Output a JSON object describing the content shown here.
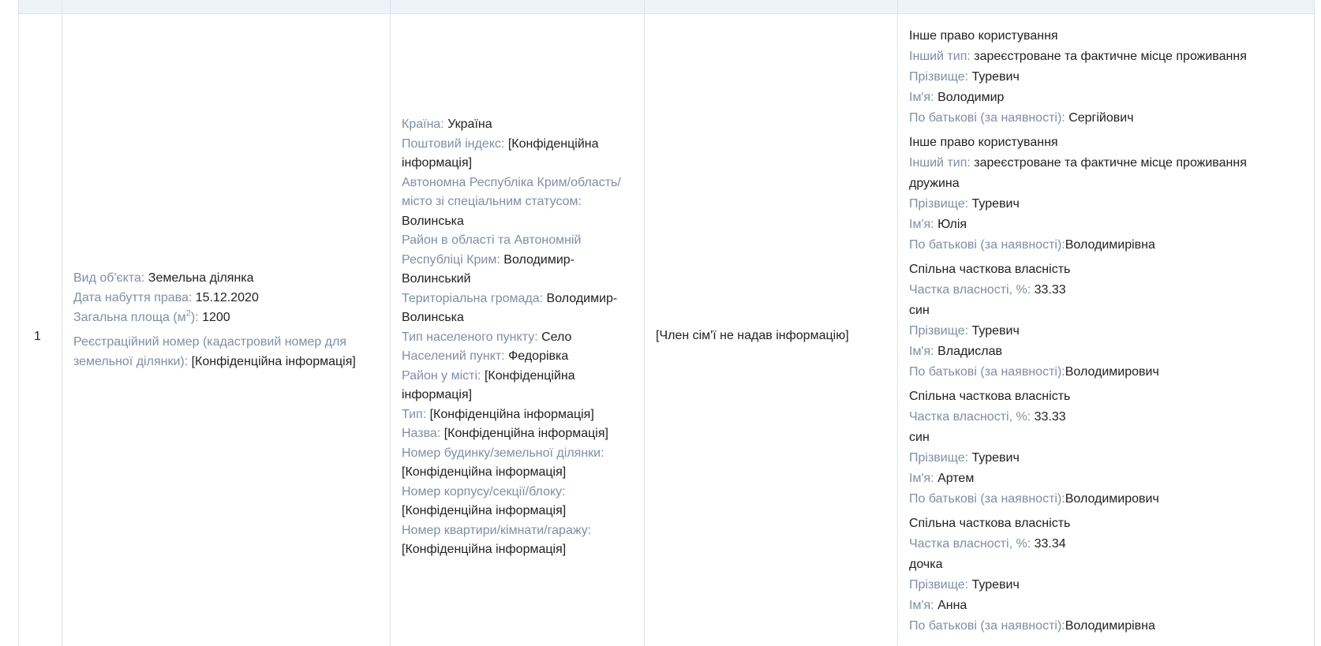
{
  "row_number": "1",
  "object": {
    "type_label": "Вид об'єкта:",
    "type_value": "Земельна ділянка",
    "date_label": "Дата набуття права:",
    "date_value": "15.12.2020",
    "area_label_prefix": "Загальна площа (м",
    "area_label_sup": "2",
    "area_label_suffix": "):",
    "area_value": "1200",
    "cadastral_label": "Реєстраційний номер (кадастровий номер для земельної ділянки):",
    "cadastral_value": "[Конфіденційна інформація]"
  },
  "address": {
    "country_label": "Країна:",
    "country_value": "Україна",
    "postal_label": "Поштовий індекс:",
    "postal_value": "[Конфіденційна інформація]",
    "region_label": "Автономна Республіка Крим/область/ місто зі спеціальним статусом:",
    "region_value": "Волинська",
    "district_label": "Район в області та Автономній Республіці Крим:",
    "district_value": "Володимир-Волинський",
    "community_label": "Територіальна громада:",
    "community_value": "Володимир-Волинська",
    "settlement_type_label": "Тип населеного пункту:",
    "settlement_type_value": "Село",
    "settlement_label": "Населений пункт:",
    "settlement_value": "Федорівка",
    "city_district_label": "Район у місті:",
    "city_district_value": "[Конфіденційна інформація]",
    "street_type_label": "Тип:",
    "street_type_value": "[Конфіденційна інформація]",
    "street_name_label": "Назва:",
    "street_name_value": "[Конфіденційна інформація]",
    "house_label": "Номер будинку/земельної ділянки:",
    "house_value": "[Конфіденційна інформація]",
    "block_label": "Номер корпусу/секції/блоку:",
    "block_value": "[Конфіденційна інформація]",
    "apt_label": "Номер квартири/кімнати/гаражу:",
    "apt_value": "[Конфіденційна інформація]"
  },
  "family": {
    "text": "[Член сім'ї не надав інформацію]"
  },
  "rights": [
    {
      "title": "Інше право користування",
      "type_label": "Інший тип:",
      "type_value": "зареєстроване та фактичне місце проживання",
      "relation": "",
      "surname_label": "Прізвище:",
      "surname_value": "Туревич",
      "name_label": "Ім'я:",
      "name_value": "Володимир",
      "patronymic_label": "По батькові (за наявності):",
      "patronymic_value": "Сергійович"
    },
    {
      "title": "Інше право користування",
      "type_label": "Інший тип:",
      "type_value": "зареєстроване та фактичне місце проживання",
      "relation": "дружина",
      "surname_label": "Прізвище:",
      "surname_value": "Туревич",
      "name_label": "Ім'я:",
      "name_value": "Юлія",
      "patronymic_label": "По батькові (за наявності):",
      "patronymic_value": "Володимирівна"
    },
    {
      "title": "Спільна часткова власність",
      "share_label": "Частка власності, %:",
      "share_value": "33.33",
      "relation": "син",
      "surname_label": "Прізвище:",
      "surname_value": "Туревич",
      "name_label": "Ім'я:",
      "name_value": "Владислав",
      "patronymic_label": "По батькові (за наявності):",
      "patronymic_value": "Володимирович"
    },
    {
      "title": "Спільна часткова власність",
      "share_label": "Частка власності, %:",
      "share_value": "33.33",
      "relation": "син",
      "surname_label": "Прізвище:",
      "surname_value": "Туревич",
      "name_label": "Ім'я:",
      "name_value": "Артем",
      "patronymic_label": "По батькові (за наявності):",
      "patronymic_value": "Володимирович"
    },
    {
      "title": "Спільна часткова власність",
      "share_label": "Частка власності, %:",
      "share_value": "33.34",
      "relation": "дочка",
      "surname_label": "Прізвище:",
      "surname_value": "Туревич",
      "name_label": "Ім'я:",
      "name_value": "Анна",
      "patronymic_label": "По батькові (за наявності):",
      "patronymic_value": "Володимирівна"
    }
  ]
}
